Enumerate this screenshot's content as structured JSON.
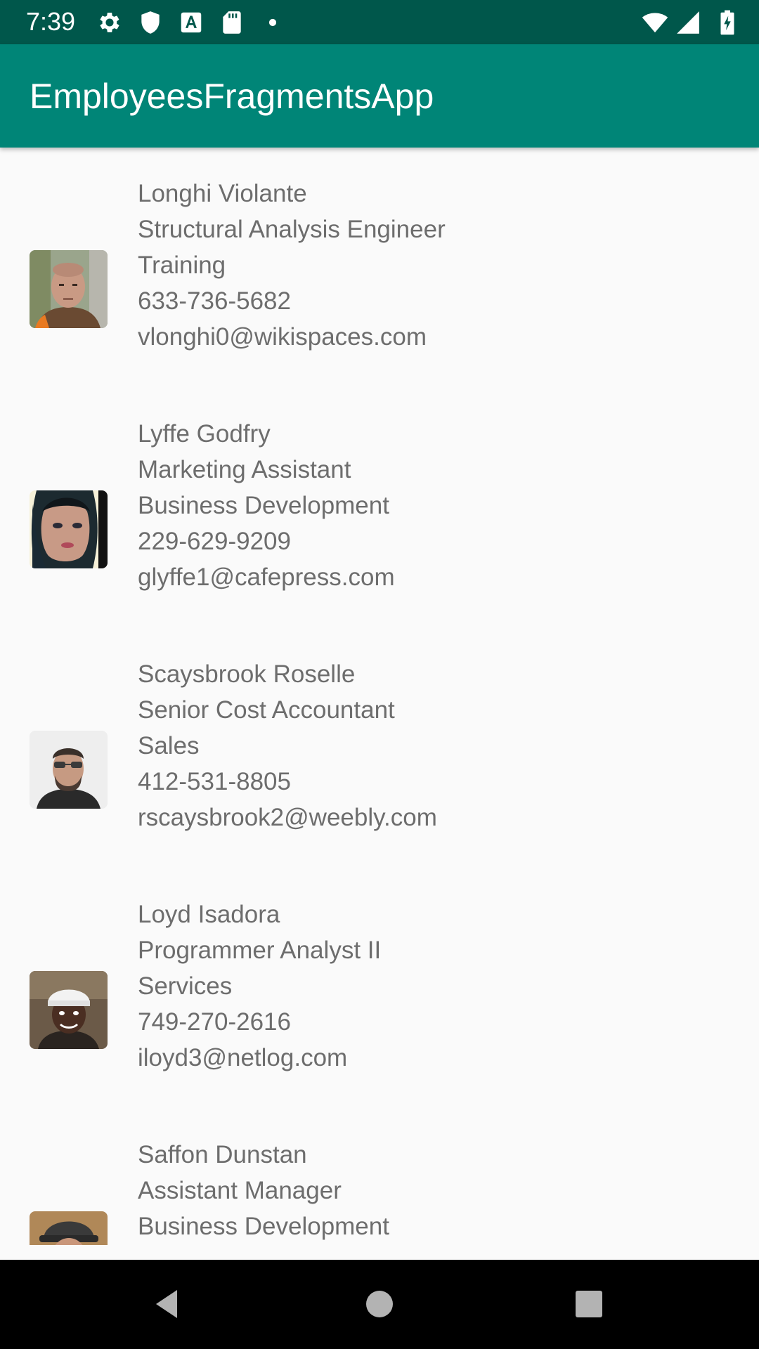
{
  "status_bar": {
    "time": "7:39",
    "left_icons": [
      "settings-gear-icon",
      "shield-icon",
      "text-a-icon",
      "sd-card-icon",
      "dot-icon"
    ],
    "right_icons": [
      "wifi-icon",
      "cell-signal-icon",
      "battery-charging-icon"
    ]
  },
  "app_bar": {
    "title": "EmployeesFragmentsApp",
    "color": "#008577"
  },
  "colors": {
    "status_bar": "#00574b",
    "primary": "#008577",
    "text_secondary": "#6d6d6d",
    "background": "#fafafa"
  },
  "employees": [
    {
      "name": "Longhi Violante",
      "title": "Structural Analysis Engineer",
      "department": "Training",
      "phone": "633-736-5682",
      "email": "vlonghi0@wikispaces.com"
    },
    {
      "name": "Lyffe Godfry",
      "title": "Marketing Assistant",
      "department": "Business Development",
      "phone": "229-629-9209",
      "email": "glyffe1@cafepress.com"
    },
    {
      "name": "Scaysbrook Roselle",
      "title": "Senior Cost Accountant",
      "department": "Sales",
      "phone": "412-531-8805",
      "email": "rscaysbrook2@weebly.com"
    },
    {
      "name": "Loyd Isadora",
      "title": "Programmer Analyst II",
      "department": "Services",
      "phone": "749-270-2616",
      "email": "iloyd3@netlog.com"
    },
    {
      "name": "Saffon Dunstan",
      "title": "Assistant Manager",
      "department": "Business Development"
    }
  ],
  "nav_bar": {
    "buttons": [
      "back-icon",
      "home-icon",
      "recents-icon"
    ]
  }
}
